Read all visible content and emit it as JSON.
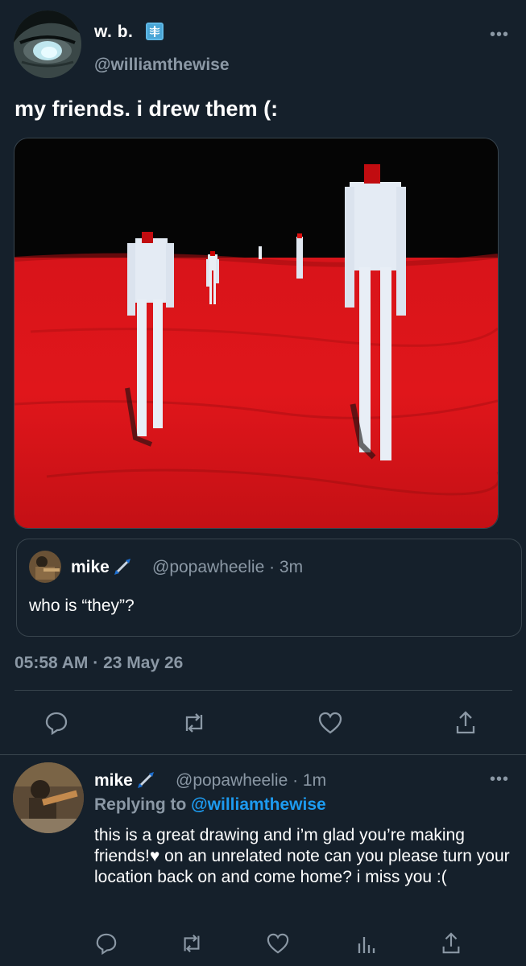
{
  "tweet": {
    "author": {
      "display_name": "w. b.",
      "handle": "@williamthewise",
      "badge_icon": "xray-emoji"
    },
    "text": "my friends. i drew them (:",
    "image": {
      "description_icon": "painting-red-field-figures"
    },
    "quote": {
      "author_name": "mike",
      "handle_time": "@popawheelie · 3m",
      "text": "who is “they”?"
    },
    "timestamp": "05:58 AM · 23 May 26",
    "more_icon": "•••"
  },
  "reply": {
    "author_name": "mike",
    "handle_time": "@popawheelie · 1m",
    "replying_prefix": "Replying to ",
    "replying_to": "@williamthewise",
    "text": "this is a great drawing and i’m glad you’re making friends!♥ on an unrelated note can you please turn your location back on and come home? i miss you :(",
    "more_icon": "•••"
  },
  "colors": {
    "background": "#15202b",
    "muted": "#8b98a5",
    "accent": "#1d9bf0",
    "divider": "#38444d"
  }
}
